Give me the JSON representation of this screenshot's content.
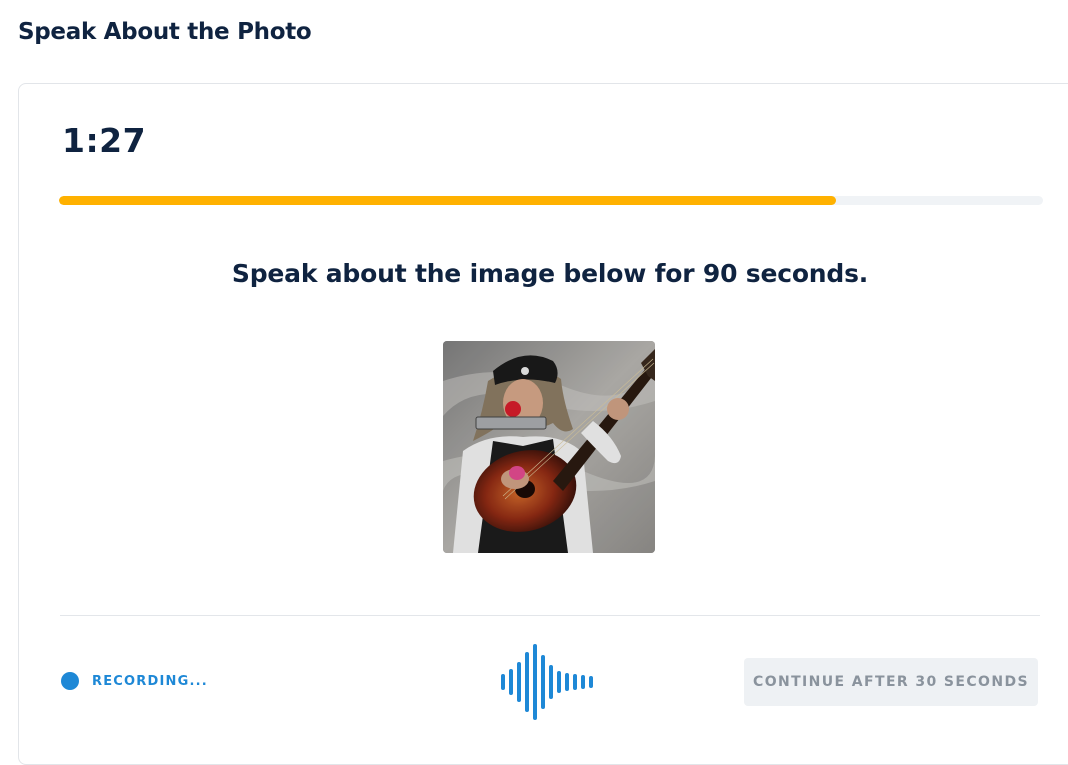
{
  "page": {
    "title": "Speak About the Photo"
  },
  "timer": {
    "remaining": "1:27"
  },
  "progress": {
    "fraction": 0.79,
    "color": "#ffb100",
    "track_color": "#f0f3f6"
  },
  "prompt": {
    "instruction": "Speak about the image below for 90 seconds."
  },
  "photo": {
    "subject": "street musician with red clown nose, black bandana with skull, harmonica holder and acoustic guitar"
  },
  "footer": {
    "recording_label": "RECORDING...",
    "recording_color": "#1e88d6",
    "waveform_icon": "audio-waveform-icon",
    "continue_label": "CONTINUE AFTER 30 SECONDS"
  }
}
